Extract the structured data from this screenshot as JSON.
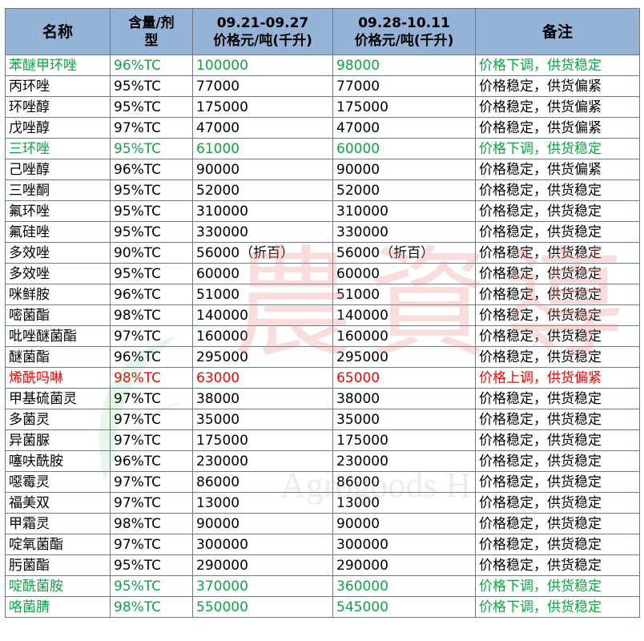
{
  "headers": {
    "name": "名称",
    "content_line1": "含量/剂",
    "content_line2": "型",
    "period1_line1": "09.21-09.27",
    "period1_line2": "价格元/吨(千升)",
    "period2_line1": "09.28-10.11",
    "period2_line2": "价格元/吨(千升)",
    "remark": "备注"
  },
  "watermark": {
    "chinese": "農資導",
    "english": "Agrogoods H"
  },
  "colors": {
    "header_bg": "#95b3d7",
    "price_down_green": "#0aa842",
    "price_up_red": "#ff0000",
    "border": "#6f7a86"
  },
  "rows": [
    {
      "name": "苯醚甲环唑",
      "content": "96%TC",
      "price1": "100000",
      "price2": "98000",
      "remark": "价格下调，供货稳定",
      "status": "down"
    },
    {
      "name": "丙环唑",
      "content": "95%TC",
      "price1": "77000",
      "price2": "77000",
      "remark": "价格稳定，供货偏紧",
      "status": "stable"
    },
    {
      "name": "环唑醇",
      "content": "95%TC",
      "price1": "175000",
      "price2": "175000",
      "remark": "价格稳定，供货偏紧",
      "status": "stable"
    },
    {
      "name": "戊唑醇",
      "content": "97%TC",
      "price1": "47000",
      "price2": "47000",
      "remark": "价格稳定，供货偏紧",
      "status": "stable"
    },
    {
      "name": "三环唑",
      "content": "95%TC",
      "price1": "61000",
      "price2": "60000",
      "remark": "价格下调，供货稳定",
      "status": "down"
    },
    {
      "name": "己唑醇",
      "content": "96%TC",
      "price1": "90000",
      "price2": "90000",
      "remark": "价格稳定，供货偏紧",
      "status": "stable"
    },
    {
      "name": "三唑酮",
      "content": "95%TC",
      "price1": "52000",
      "price2": "52000",
      "remark": "价格稳定，供货稳定",
      "status": "stable"
    },
    {
      "name": "氟环唑",
      "content": "95%TC",
      "price1": "310000",
      "price2": "310000",
      "remark": "价格稳定，供货稳定",
      "status": "stable"
    },
    {
      "name": "氟硅唑",
      "content": "95%TC",
      "price1": "330000",
      "price2": "330000",
      "remark": "价格稳定，供货稳定",
      "status": "stable"
    },
    {
      "name": "多效唑",
      "content": "90%TC",
      "price1": "56000（折百）",
      "price2": "56000（折百）",
      "remark": "价格稳定，供货稳定",
      "status": "stable"
    },
    {
      "name": "多效唑",
      "content": "95%TC",
      "price1": "60000",
      "price2": "60000",
      "remark": "价格稳定，供货稳定",
      "status": "stable"
    },
    {
      "name": "咪鲜胺",
      "content": "96%TC",
      "price1": "51000",
      "price2": "51000",
      "remark": "价格稳定，供货稳定",
      "status": "stable"
    },
    {
      "name": "嘧菌酯",
      "content": "98%TC",
      "price1": "140000",
      "price2": "140000",
      "remark": "价格稳定，供货稳定",
      "status": "stable"
    },
    {
      "name": "吡唑醚菌酯",
      "content": "97%TC",
      "price1": "160000",
      "price2": "160000",
      "remark": "价格稳定，供货稳定",
      "status": "stable"
    },
    {
      "name": "醚菌酯",
      "content": "96%TC",
      "price1": "295000",
      "price2": "295000",
      "remark": "价格稳定，供货稳定",
      "status": "stable"
    },
    {
      "name": "烯酰吗啉",
      "content": "98%TC",
      "price1": "63000",
      "price2": "65000",
      "remark": "价格上调，供货偏紧",
      "status": "up"
    },
    {
      "name": "甲基硫菌灵",
      "content": "97%TC",
      "price1": "38000",
      "price2": "38000",
      "remark": "价格稳定，供货稳定",
      "status": "stable"
    },
    {
      "name": "多菌灵",
      "content": "97%TC",
      "price1": "35000",
      "price2": "35000",
      "remark": "价格稳定，供货稳定",
      "status": "stable"
    },
    {
      "name": "异菌脲",
      "content": "97%TC",
      "price1": "175000",
      "price2": "175000",
      "remark": "价格稳定，供货稳定",
      "status": "stable"
    },
    {
      "name": "噻呋酰胺",
      "content": "96%TC",
      "price1": "230000",
      "price2": "230000",
      "remark": "价格稳定，供货稳定",
      "status": "stable"
    },
    {
      "name": "噁霉灵",
      "content": "97%TC",
      "price1": "86000",
      "price2": "86000",
      "remark": "价格稳定，供货稳定",
      "status": "stable"
    },
    {
      "name": "福美双",
      "content": "97%TC",
      "price1": "13000",
      "price2": "13000",
      "remark": "价格稳定，供货稳定",
      "status": "stable"
    },
    {
      "name": "甲霜灵",
      "content": "98%TC",
      "price1": "90000",
      "price2": "90000",
      "remark": "价格稳定，供货稳定",
      "status": "stable"
    },
    {
      "name": "啶氧菌酯",
      "content": "97%TC",
      "price1": "300000",
      "price2": "300000",
      "remark": "价格稳定，供货稳定",
      "status": "stable"
    },
    {
      "name": "肟菌酯",
      "content": "95%TC",
      "price1": "290000",
      "price2": "290000",
      "remark": "价格稳定，供货稳定",
      "status": "stable"
    },
    {
      "name": "啶酰菌胺",
      "content": "95%TC",
      "price1": "370000",
      "price2": "360000",
      "remark": "价格下调，供货稳定",
      "status": "down"
    },
    {
      "name": "咯菌腈",
      "content": "98%TC",
      "price1": "550000",
      "price2": "545000",
      "remark": "价格下调，供货稳定",
      "status": "down"
    }
  ]
}
